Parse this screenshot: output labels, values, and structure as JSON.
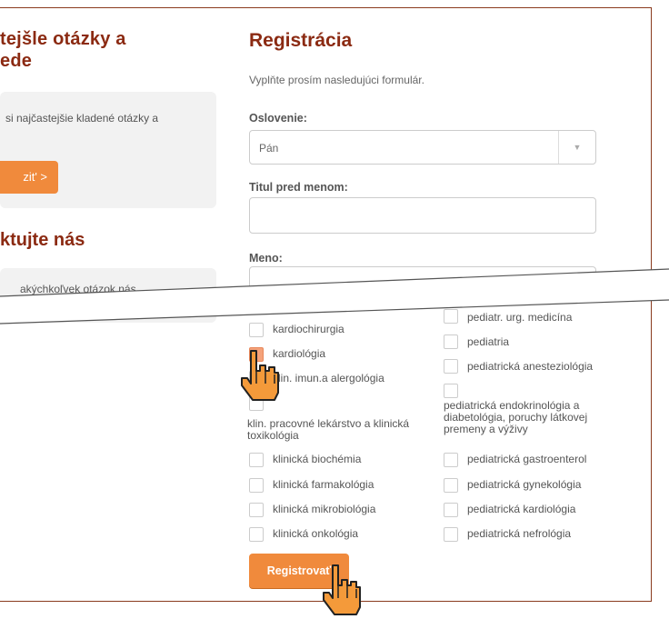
{
  "faq": {
    "title_line1": "tejšle otázky a",
    "title_line2": "ede",
    "card_text": "si najčastejšie kladené otázky a",
    "button_label": "zit' >"
  },
  "contact": {
    "title": "ktujte nás",
    "card_text": "akýchkoľvek otázok nás"
  },
  "form": {
    "title": "Registrácia",
    "subtitle": "Vyplňte prosím nasledujúci formulár.",
    "salutation_label": "Oslovenie:",
    "salutation_value": "Pán",
    "title_before_label": "Titul pred menom:",
    "name_label": "Meno:",
    "submit_label": "Registrovať"
  },
  "specialties_left": [
    {
      "label": "kardiochirurgia",
      "checked": false
    },
    {
      "label": "kardiológia",
      "checked": true
    },
    {
      "label": "klin. imun.a alergológia",
      "checked": false
    },
    {
      "label": "klin. pracovné lekárstvo a klinická toxikológia",
      "checked": false
    },
    {
      "label": "klinická biochémia",
      "checked": false
    },
    {
      "label": "klinická farmakológia",
      "checked": false
    },
    {
      "label": "klinická mikrobiológia",
      "checked": false
    },
    {
      "label": "klinická onkológia",
      "checked": false
    }
  ],
  "specialties_right": [
    {
      "label": "pediatr. urg. medicína",
      "checked": false
    },
    {
      "label": "pediatria",
      "checked": false
    },
    {
      "label": "pediatrická anesteziológia",
      "checked": false
    },
    {
      "label": "pediatrická endokrinológia a diabetológia, poruchy látkovej premeny a výživy",
      "checked": false
    },
    {
      "label": "pediatrická gastroenterol",
      "checked": false
    },
    {
      "label": "pediatrická gynekológia",
      "checked": false
    },
    {
      "label": "pediatrická kardiológia",
      "checked": false
    },
    {
      "label": "pediatrická nefrológia",
      "checked": false
    }
  ],
  "colors": {
    "accent": "#f08a3c",
    "heading": "#8b2a12",
    "frame": "#8a3a1e"
  }
}
